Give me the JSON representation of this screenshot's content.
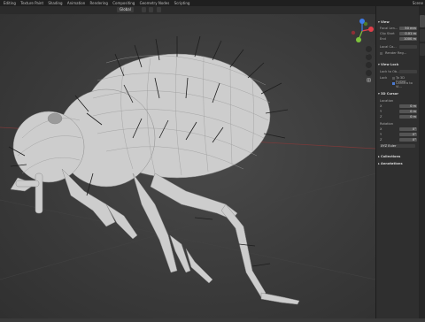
{
  "topbar": {
    "menus": [
      "Editing",
      "Texture Paint",
      "Shading",
      "Animation",
      "Rendering",
      "Compositing",
      "Geometry Nodes",
      "Scripting"
    ],
    "scene_label": "Scene"
  },
  "header": {
    "view_mode": "Global"
  },
  "npanel": {
    "view_section": "View",
    "focal_length_label": "Focal Len...",
    "focal_length_value": "50 mm",
    "clip_start_label": "Clip Start",
    "clip_start_value": "0.01 m",
    "clip_end_label": "End",
    "clip_end_value": "1000 m",
    "local_camera_label": "Local Ca...",
    "render_region_label": "Render Reg...",
    "view_lock_section": "View Lock",
    "lock_to_object_label": "Lock to Ob...",
    "lock_label": "Lock",
    "to_3d_cursor_label": "To 3D Cursor",
    "camera_to_view_label": "Camera to Vi...",
    "cursor_section": "3D Cursor",
    "location_label": "Location",
    "loc_x": "0 m",
    "loc_y": "0 m",
    "loc_z": "0 m",
    "rotation_label": "Rotation",
    "rot_x": "0°",
    "rot_y": "0°",
    "rot_z": "0°",
    "rotation_mode": "XYZ Euler",
    "collections_section": "Collections",
    "annotations_section": "Annotations"
  },
  "colors": {
    "viewport_bg": "#3a3a3a",
    "axis_x": "#e0404a",
    "axis_y": "#7ec23c",
    "axis_z": "#3e7ce8",
    "mesh": "#cfcfcf",
    "wire": "#8c8c8c"
  }
}
